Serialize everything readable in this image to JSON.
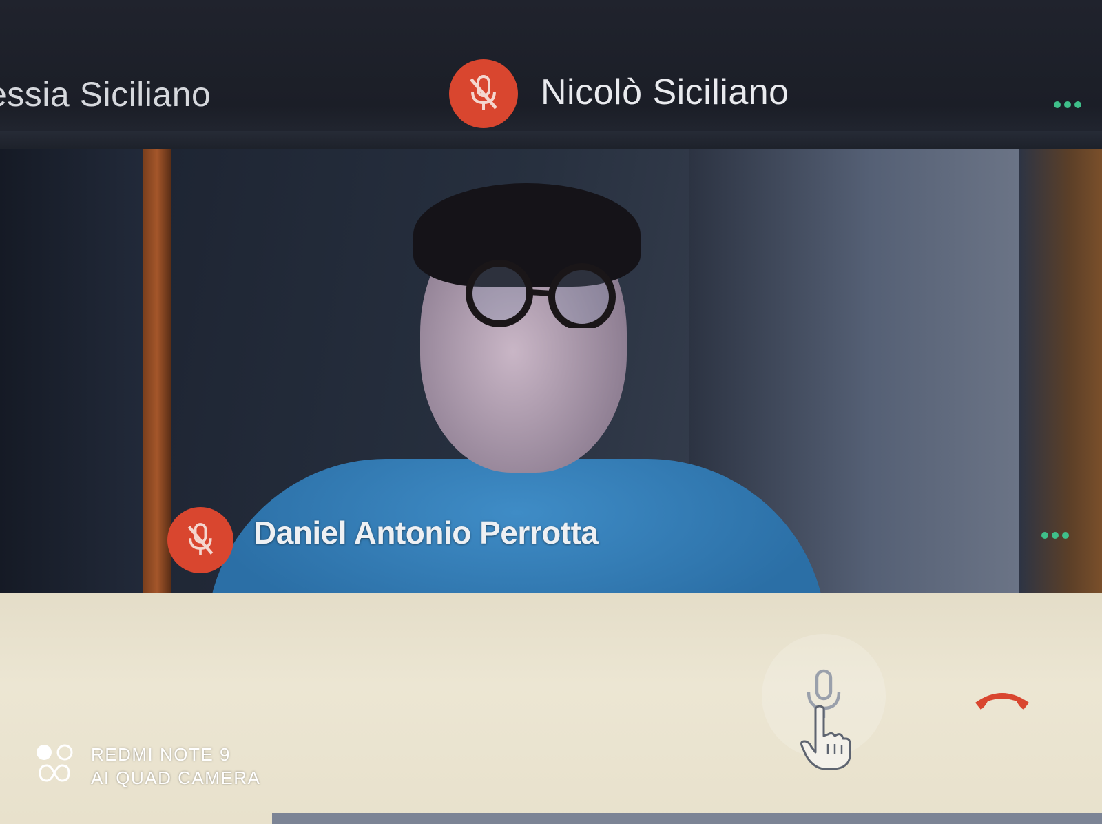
{
  "top_strip": {
    "left_participant_name": "essia Siciliano",
    "center_participant_name": "Nicolò Siciliano"
  },
  "video_tile": {
    "participant_name": "Daniel Antonio Perrotta",
    "mic_status": "muted"
  },
  "controls": {
    "mic_button_icon": "microphone-icon",
    "hangup_button_icon": "hang-up-phone-icon",
    "pointer_icon": "hand-pointer-icon"
  },
  "watermark": {
    "line1": "REDMI NOTE 9",
    "line2": "AI QUAD CAMERA"
  },
  "colors": {
    "mute_badge": "#d9462f",
    "more_dots": "#3fbf8a",
    "hangup": "#d9462f",
    "control_bar": "#ece6d3"
  }
}
